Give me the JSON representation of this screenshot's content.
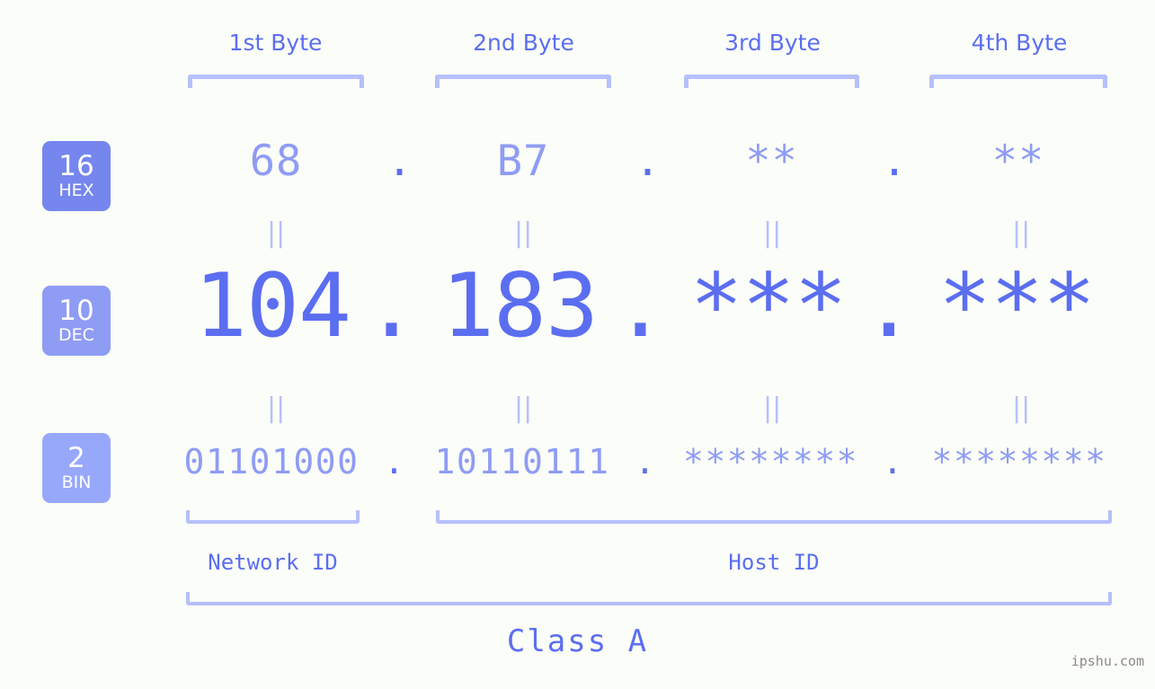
{
  "page": {
    "title": "IP Address Byte Breakdown",
    "background_color": "#fbfdf8",
    "accent_color": "#5b6ef0",
    "accent_light_color": "#8e9cf4",
    "bracket_color": "#b6c0fb",
    "watermark": "ipshu.com"
  },
  "byte_headers": [
    {
      "label": "1st Byte"
    },
    {
      "label": "2nd Byte"
    },
    {
      "label": "3rd Byte"
    },
    {
      "label": "4th Byte"
    }
  ],
  "bases": [
    {
      "number": "16",
      "name": "HEX",
      "color": "#7586ee"
    },
    {
      "number": "10",
      "name": "DEC",
      "color": "#8e9cf4"
    },
    {
      "number": "2",
      "name": "BIN",
      "color": "#97a8fa"
    }
  ],
  "rows": {
    "hex": {
      "base_number": "16",
      "base_name": "HEX",
      "values": [
        "68",
        "B7",
        "**",
        "**"
      ],
      "separators": [
        ".",
        ".",
        "."
      ]
    },
    "dec": {
      "base_number": "10",
      "base_name": "DEC",
      "values": [
        "104",
        "183",
        "***",
        "***"
      ],
      "separators": [
        ".",
        ".",
        "."
      ]
    },
    "bin": {
      "base_number": "2",
      "base_name": "BIN",
      "values": [
        "01101000",
        "10110111",
        "********",
        "********"
      ],
      "separators": [
        ".",
        ".",
        "."
      ]
    }
  },
  "equality_marks": {
    "glyph": "||",
    "count_per_row": 4
  },
  "segments": [
    {
      "label": "Network ID"
    },
    {
      "label": "Host ID"
    }
  ],
  "class": {
    "label": "Class A"
  }
}
